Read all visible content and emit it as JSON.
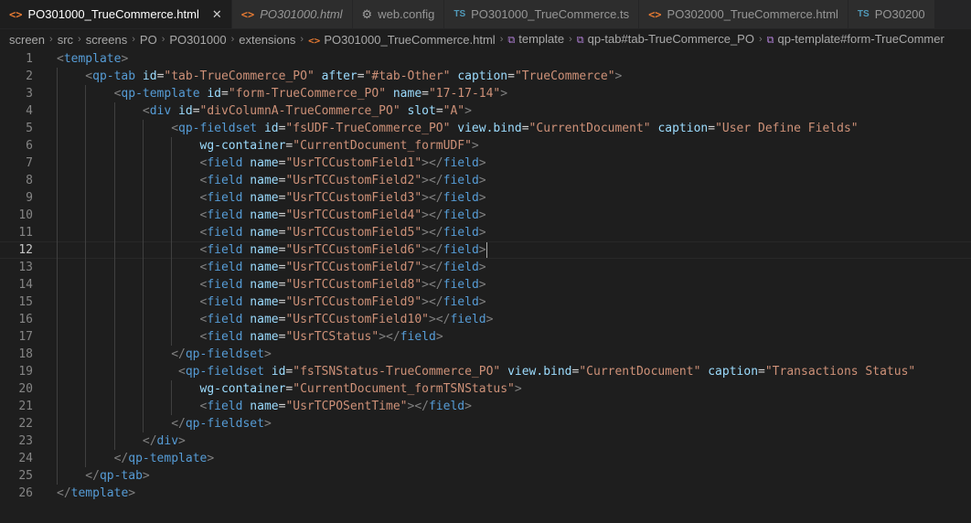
{
  "tabs": [
    {
      "icon": "<>",
      "label": "PO301000_TrueCommerce.html",
      "active": true,
      "close": "✕",
      "italic": false,
      "icon_type": "html"
    },
    {
      "icon": "<>",
      "label": "PO301000.html",
      "active": false,
      "italic": true,
      "icon_type": "html"
    },
    {
      "icon": "⚙",
      "label": "web.config",
      "active": false,
      "italic": false,
      "icon_type": "gear"
    },
    {
      "icon": "TS",
      "label": "PO301000_TrueCommerce.ts",
      "active": false,
      "italic": false,
      "icon_type": "ts"
    },
    {
      "icon": "<>",
      "label": "PO302000_TrueCommerce.html",
      "active": false,
      "italic": false,
      "icon_type": "html"
    },
    {
      "icon": "TS",
      "label": "PO30200",
      "active": false,
      "italic": false,
      "icon_type": "ts"
    }
  ],
  "breadcrumb": [
    {
      "label": "screen"
    },
    {
      "label": "src"
    },
    {
      "label": "screens"
    },
    {
      "label": "PO"
    },
    {
      "label": "PO301000"
    },
    {
      "label": "extensions"
    },
    {
      "label": "PO301000_TrueCommerce.html",
      "icon": "<>"
    },
    {
      "label": "template",
      "icon": "⧉"
    },
    {
      "label": "qp-tab#tab-TrueCommerce_PO",
      "icon": "⧉"
    },
    {
      "label": "qp-template#form-TrueCommer",
      "icon": "⧉"
    }
  ],
  "editor": {
    "current_line": 12,
    "lines": [
      {
        "n": "1",
        "indent": 0,
        "tokens": [
          [
            "t",
            "<"
          ],
          [
            "tn",
            "template"
          ],
          [
            "t",
            ">"
          ]
        ]
      },
      {
        "n": "2",
        "indent": 1,
        "tokens": [
          [
            "t",
            "<"
          ],
          [
            "tn",
            "qp-tab"
          ],
          [
            "sp",
            " "
          ],
          [
            "an",
            "id"
          ],
          [
            "eq",
            "="
          ],
          [
            "av",
            "\"tab-TrueCommerce_PO\""
          ],
          [
            "sp",
            " "
          ],
          [
            "an",
            "after"
          ],
          [
            "eq",
            "="
          ],
          [
            "av",
            "\"#tab-Other\""
          ],
          [
            "sp",
            " "
          ],
          [
            "an",
            "caption"
          ],
          [
            "eq",
            "="
          ],
          [
            "av",
            "\"TrueCommerce\""
          ],
          [
            "t",
            ">"
          ]
        ]
      },
      {
        "n": "3",
        "indent": 2,
        "tokens": [
          [
            "t",
            "<"
          ],
          [
            "tn",
            "qp-template"
          ],
          [
            "sp",
            " "
          ],
          [
            "an",
            "id"
          ],
          [
            "eq",
            "="
          ],
          [
            "av",
            "\"form-TrueCommerce_PO\""
          ],
          [
            "sp",
            " "
          ],
          [
            "an",
            "name"
          ],
          [
            "eq",
            "="
          ],
          [
            "av",
            "\"17-17-14\""
          ],
          [
            "t",
            ">"
          ]
        ]
      },
      {
        "n": "4",
        "indent": 3,
        "tokens": [
          [
            "t",
            "<"
          ],
          [
            "tn",
            "div"
          ],
          [
            "sp",
            " "
          ],
          [
            "an",
            "id"
          ],
          [
            "eq",
            "="
          ],
          [
            "av",
            "\"divColumnA-TrueCommerce_PO\""
          ],
          [
            "sp",
            " "
          ],
          [
            "an",
            "slot"
          ],
          [
            "eq",
            "="
          ],
          [
            "av",
            "\"A\""
          ],
          [
            "t",
            ">"
          ]
        ]
      },
      {
        "n": "5",
        "indent": 4,
        "tokens": [
          [
            "t",
            "<"
          ],
          [
            "tn",
            "qp-fieldset"
          ],
          [
            "sp",
            " "
          ],
          [
            "an",
            "id"
          ],
          [
            "eq",
            "="
          ],
          [
            "av",
            "\"fsUDF-TrueCommerce_PO\""
          ],
          [
            "sp",
            " "
          ],
          [
            "an",
            "view.bind"
          ],
          [
            "eq",
            "="
          ],
          [
            "av",
            "\"CurrentDocument\""
          ],
          [
            "sp",
            " "
          ],
          [
            "an",
            "caption"
          ],
          [
            "eq",
            "="
          ],
          [
            "av",
            "\"User Define Fields\""
          ]
        ]
      },
      {
        "n": "6",
        "indent": 5,
        "tokens": [
          [
            "an",
            "wg-container"
          ],
          [
            "eq",
            "="
          ],
          [
            "av",
            "\"CurrentDocument_formUDF\""
          ],
          [
            "t",
            ">"
          ]
        ]
      },
      {
        "n": "7",
        "indent": 5,
        "tokens": [
          [
            "t",
            "<"
          ],
          [
            "tn",
            "field"
          ],
          [
            "sp",
            " "
          ],
          [
            "an",
            "name"
          ],
          [
            "eq",
            "="
          ],
          [
            "av",
            "\"UsrTCCustomField1\""
          ],
          [
            "t",
            "></"
          ],
          [
            "tn",
            "field"
          ],
          [
            "t",
            ">"
          ]
        ]
      },
      {
        "n": "8",
        "indent": 5,
        "tokens": [
          [
            "t",
            "<"
          ],
          [
            "tn",
            "field"
          ],
          [
            "sp",
            " "
          ],
          [
            "an",
            "name"
          ],
          [
            "eq",
            "="
          ],
          [
            "av",
            "\"UsrTCCustomField2\""
          ],
          [
            "t",
            "></"
          ],
          [
            "tn",
            "field"
          ],
          [
            "t",
            ">"
          ]
        ]
      },
      {
        "n": "9",
        "indent": 5,
        "tokens": [
          [
            "t",
            "<"
          ],
          [
            "tn",
            "field"
          ],
          [
            "sp",
            " "
          ],
          [
            "an",
            "name"
          ],
          [
            "eq",
            "="
          ],
          [
            "av",
            "\"UsrTCCustomField3\""
          ],
          [
            "t",
            "></"
          ],
          [
            "tn",
            "field"
          ],
          [
            "t",
            ">"
          ]
        ]
      },
      {
        "n": "10",
        "indent": 5,
        "tokens": [
          [
            "t",
            "<"
          ],
          [
            "tn",
            "field"
          ],
          [
            "sp",
            " "
          ],
          [
            "an",
            "name"
          ],
          [
            "eq",
            "="
          ],
          [
            "av",
            "\"UsrTCCustomField4\""
          ],
          [
            "t",
            "></"
          ],
          [
            "tn",
            "field"
          ],
          [
            "t",
            ">"
          ]
        ]
      },
      {
        "n": "11",
        "indent": 5,
        "tokens": [
          [
            "t",
            "<"
          ],
          [
            "tn",
            "field"
          ],
          [
            "sp",
            " "
          ],
          [
            "an",
            "name"
          ],
          [
            "eq",
            "="
          ],
          [
            "av",
            "\"UsrTCCustomField5\""
          ],
          [
            "t",
            "></"
          ],
          [
            "tn",
            "field"
          ],
          [
            "t",
            ">"
          ]
        ]
      },
      {
        "n": "12",
        "indent": 5,
        "tokens": [
          [
            "t",
            "<"
          ],
          [
            "tn",
            "field"
          ],
          [
            "sp",
            " "
          ],
          [
            "an",
            "name"
          ],
          [
            "eq",
            "="
          ],
          [
            "av",
            "\"UsrTCCustomField6\""
          ],
          [
            "t",
            "></"
          ],
          [
            "tn",
            "field"
          ],
          [
            "t",
            ">"
          ]
        ],
        "caret": true
      },
      {
        "n": "13",
        "indent": 5,
        "tokens": [
          [
            "t",
            "<"
          ],
          [
            "tn",
            "field"
          ],
          [
            "sp",
            " "
          ],
          [
            "an",
            "name"
          ],
          [
            "eq",
            "="
          ],
          [
            "av",
            "\"UsrTCCustomField7\""
          ],
          [
            "t",
            "></"
          ],
          [
            "tn",
            "field"
          ],
          [
            "t",
            ">"
          ]
        ]
      },
      {
        "n": "14",
        "indent": 5,
        "tokens": [
          [
            "t",
            "<"
          ],
          [
            "tn",
            "field"
          ],
          [
            "sp",
            " "
          ],
          [
            "an",
            "name"
          ],
          [
            "eq",
            "="
          ],
          [
            "av",
            "\"UsrTCCustomField8\""
          ],
          [
            "t",
            "></"
          ],
          [
            "tn",
            "field"
          ],
          [
            "t",
            ">"
          ]
        ]
      },
      {
        "n": "15",
        "indent": 5,
        "tokens": [
          [
            "t",
            "<"
          ],
          [
            "tn",
            "field"
          ],
          [
            "sp",
            " "
          ],
          [
            "an",
            "name"
          ],
          [
            "eq",
            "="
          ],
          [
            "av",
            "\"UsrTCCustomField9\""
          ],
          [
            "t",
            "></"
          ],
          [
            "tn",
            "field"
          ],
          [
            "t",
            ">"
          ]
        ]
      },
      {
        "n": "16",
        "indent": 5,
        "tokens": [
          [
            "t",
            "<"
          ],
          [
            "tn",
            "field"
          ],
          [
            "sp",
            " "
          ],
          [
            "an",
            "name"
          ],
          [
            "eq",
            "="
          ],
          [
            "av",
            "\"UsrTCCustomField10\""
          ],
          [
            "t",
            "></"
          ],
          [
            "tn",
            "field"
          ],
          [
            "t",
            ">"
          ]
        ]
      },
      {
        "n": "17",
        "indent": 5,
        "tokens": [
          [
            "t",
            "<"
          ],
          [
            "tn",
            "field"
          ],
          [
            "sp",
            " "
          ],
          [
            "an",
            "name"
          ],
          [
            "eq",
            "="
          ],
          [
            "av",
            "\"UsrTCStatus\""
          ],
          [
            "t",
            "></"
          ],
          [
            "tn",
            "field"
          ],
          [
            "t",
            ">"
          ]
        ]
      },
      {
        "n": "18",
        "indent": 4,
        "tokens": [
          [
            "t",
            "</"
          ],
          [
            "tn",
            "qp-fieldset"
          ],
          [
            "t",
            ">"
          ]
        ]
      },
      {
        "n": "19",
        "indent": 4,
        "tokens": [
          [
            "sp",
            " "
          ],
          [
            "t",
            "<"
          ],
          [
            "tn",
            "qp-fieldset"
          ],
          [
            "sp",
            " "
          ],
          [
            "an",
            "id"
          ],
          [
            "eq",
            "="
          ],
          [
            "av",
            "\"fsTSNStatus-TrueCommerce_PO\""
          ],
          [
            "sp",
            " "
          ],
          [
            "an",
            "view.bind"
          ],
          [
            "eq",
            "="
          ],
          [
            "av",
            "\"CurrentDocument\""
          ],
          [
            "sp",
            " "
          ],
          [
            "an",
            "caption"
          ],
          [
            "eq",
            "="
          ],
          [
            "av",
            "\"Transactions Status\""
          ]
        ]
      },
      {
        "n": "20",
        "indent": 5,
        "tokens": [
          [
            "an",
            "wg-container"
          ],
          [
            "eq",
            "="
          ],
          [
            "av",
            "\"CurrentDocument_formTSNStatus\""
          ],
          [
            "t",
            ">"
          ]
        ]
      },
      {
        "n": "21",
        "indent": 5,
        "tokens": [
          [
            "t",
            "<"
          ],
          [
            "tn",
            "field"
          ],
          [
            "sp",
            " "
          ],
          [
            "an",
            "name"
          ],
          [
            "eq",
            "="
          ],
          [
            "av",
            "\"UsrTCPOSentTime\""
          ],
          [
            "t",
            "></"
          ],
          [
            "tn",
            "field"
          ],
          [
            "t",
            ">"
          ]
        ]
      },
      {
        "n": "22",
        "indent": 4,
        "tokens": [
          [
            "t",
            "</"
          ],
          [
            "tn",
            "qp-fieldset"
          ],
          [
            "t",
            ">"
          ]
        ]
      },
      {
        "n": "23",
        "indent": 3,
        "tokens": [
          [
            "t",
            "</"
          ],
          [
            "tn",
            "div"
          ],
          [
            "t",
            ">"
          ]
        ]
      },
      {
        "n": "24",
        "indent": 2,
        "tokens": [
          [
            "t",
            "</"
          ],
          [
            "tn",
            "qp-template"
          ],
          [
            "t",
            ">"
          ]
        ]
      },
      {
        "n": "25",
        "indent": 1,
        "tokens": [
          [
            "t",
            "</"
          ],
          [
            "tn",
            "qp-tab"
          ],
          [
            "t",
            ">"
          ]
        ]
      },
      {
        "n": "26",
        "indent": 0,
        "tokens": [
          [
            "t",
            "</"
          ],
          [
            "tn",
            "template"
          ],
          [
            "t",
            ">"
          ]
        ]
      }
    ]
  }
}
